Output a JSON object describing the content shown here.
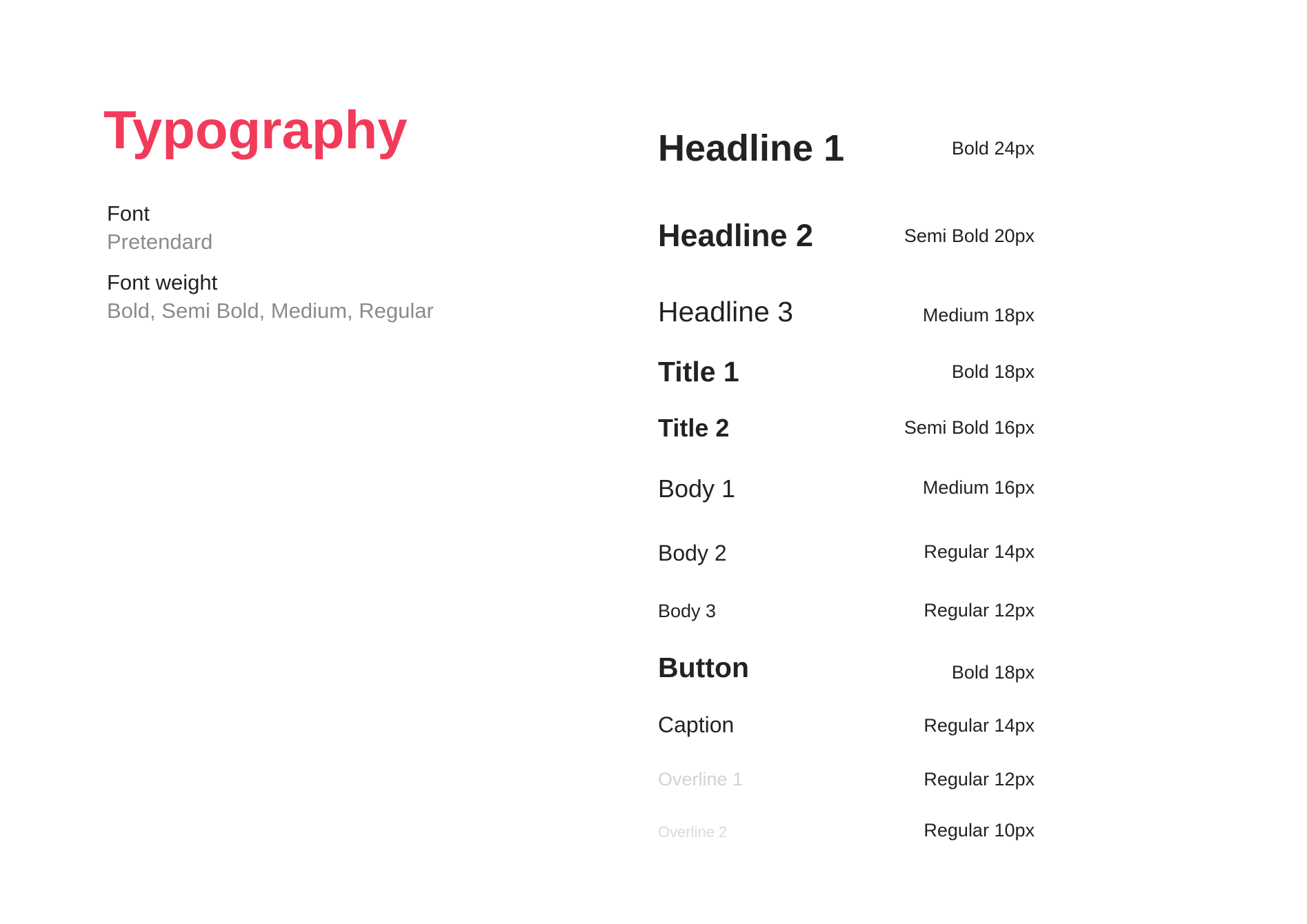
{
  "header": {
    "title": "Typography",
    "accent_color": "#f23a5a"
  },
  "info": {
    "font_label": "Font",
    "font_value": "Pretendard",
    "weight_label": "Font weight",
    "weight_value": "Bold, Semi Bold, Medium, Regular"
  },
  "styles": [
    {
      "name": "Headline 1",
      "spec": "Bold 24px"
    },
    {
      "name": "Headline 2",
      "spec": "Semi Bold 20px"
    },
    {
      "name": "Headline 3",
      "spec": "Medium 18px"
    },
    {
      "name": "Title 1",
      "spec": "Bold 18px"
    },
    {
      "name": "Title 2",
      "spec": "Semi Bold 16px"
    },
    {
      "name": "Body 1",
      "spec": "Medium 16px"
    },
    {
      "name": "Body 2",
      "spec": "Regular 14px"
    },
    {
      "name": "Body 3",
      "spec": "Regular 12px"
    },
    {
      "name": "Button",
      "spec": "Bold 18px"
    },
    {
      "name": "Caption",
      "spec": "Regular 14px"
    },
    {
      "name": "Overline 1",
      "spec": "Regular 12px"
    },
    {
      "name": "Overline 2",
      "spec": "Regular 10px"
    }
  ]
}
